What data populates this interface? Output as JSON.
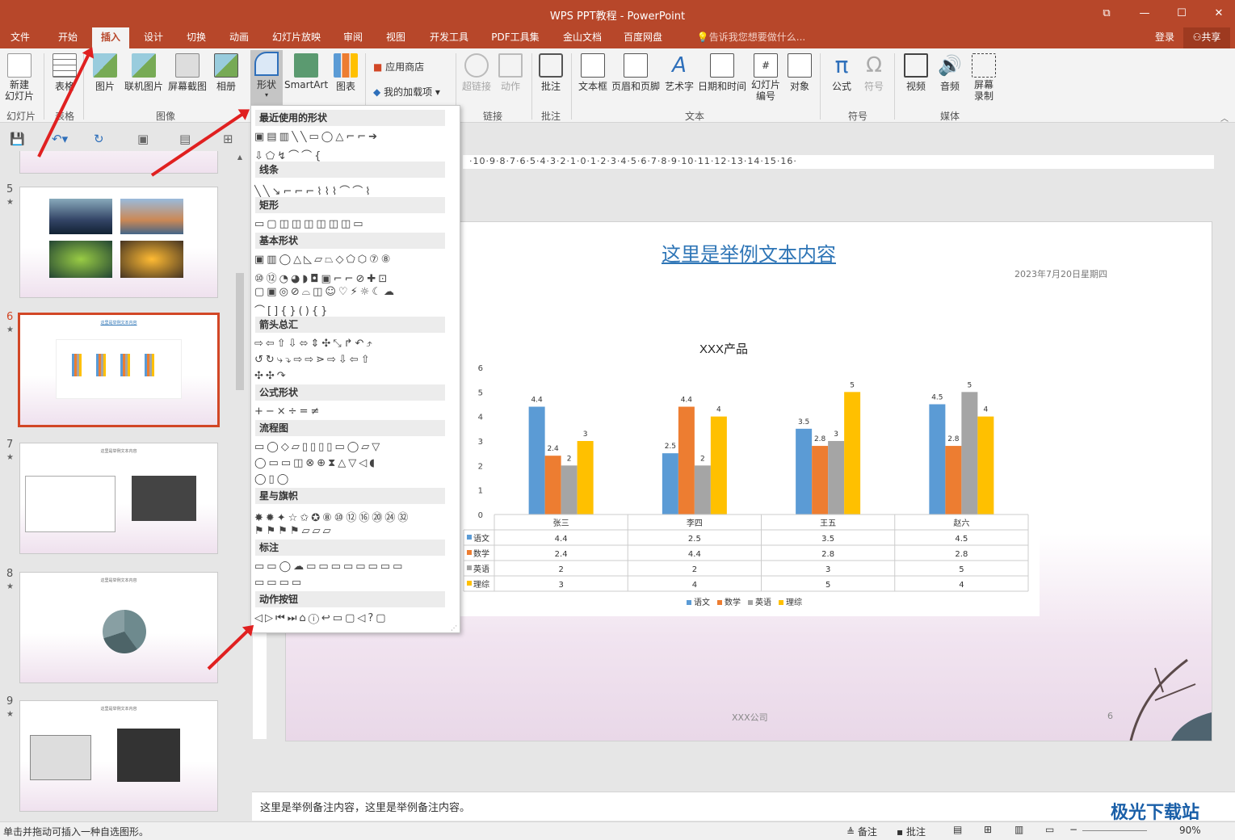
{
  "app": {
    "title": "WPS PPT教程 - PowerPoint"
  },
  "menu": {
    "items": [
      "文件",
      "开始",
      "插入",
      "设计",
      "切换",
      "动画",
      "幻灯片放映",
      "审阅",
      "视图",
      "开发工具",
      "PDF工具集",
      "金山文档",
      "百度网盘"
    ],
    "tellme": "告诉我您想要做什么...",
    "login": "登录",
    "share": "共享"
  },
  "ribbon": {
    "new_slide": "新建\n幻灯片",
    "table": "表格",
    "picture": "图片",
    "online_picture": "联机图片",
    "screenshot": "屏幕截图",
    "album": "相册",
    "shapes": "形状",
    "smartart": "SmartArt",
    "chart": "图表",
    "store": "应用商店",
    "addins": "我的加载项",
    "hyperlink": "超链接",
    "action": "动作",
    "comment": "批注",
    "textbox": "文本框",
    "header_footer": "页眉和页脚",
    "wordart": "艺术字",
    "datetime": "日期和时间",
    "slide_num": "幻灯片\n编号",
    "object": "对象",
    "equation": "公式",
    "symbol": "符号",
    "video": "视频",
    "audio": "音频",
    "screen_rec": "屏幕\n录制",
    "groups": {
      "slides": "幻灯片",
      "tables": "表格",
      "images": "图像",
      "links": "链接",
      "comments": "批注",
      "text": "文本",
      "symbols": "符号",
      "media": "媒体"
    }
  },
  "shapes_menu": {
    "sections": [
      "最近使用的形状",
      "线条",
      "矩形",
      "基本形状",
      "箭头总汇",
      "公式形状",
      "流程图",
      "星与旗帜",
      "标注",
      "动作按钮"
    ]
  },
  "thumbs": [
    {
      "n": "5"
    },
    {
      "n": "6"
    },
    {
      "n": "7"
    },
    {
      "n": "8"
    },
    {
      "n": "9"
    }
  ],
  "slide": {
    "title": "这里是举例文本内容",
    "date": "2023年7月20日星期四",
    "company": "XXX公司",
    "page": "6"
  },
  "chart_data": {
    "type": "bar",
    "title": "XXX产品",
    "categories": [
      "张三",
      "李四",
      "王五",
      "赵六"
    ],
    "ylim": [
      0,
      6
    ],
    "yticks": [
      "0",
      "1",
      "2",
      "3",
      "4",
      "5",
      "6"
    ],
    "series": [
      {
        "name": "语文",
        "color": "#5b9bd5",
        "values": [
          4.4,
          2.5,
          3.5,
          4.5
        ]
      },
      {
        "name": "数学",
        "color": "#ed7d31",
        "values": [
          2.4,
          4.4,
          2.8,
          2.8
        ]
      },
      {
        "name": "英语",
        "color": "#a5a5a5",
        "values": [
          2,
          2,
          3,
          5
        ]
      },
      {
        "name": "理综",
        "color": "#ffc000",
        "values": [
          3,
          4,
          5,
          4
        ]
      }
    ],
    "legend": "bottom"
  },
  "chart_table": {
    "rows": [
      [
        "语文",
        "4.4",
        "2.5",
        "3.5",
        "4.5"
      ],
      [
        "数学",
        "2.4",
        "4.4",
        "2.8",
        "2.8"
      ],
      [
        "英语",
        "2",
        "2",
        "3",
        "5"
      ],
      [
        "理综",
        "3",
        "4",
        "5",
        "4"
      ]
    ]
  },
  "notes": "这里是举例备注内容，这里是举例备注内容。",
  "status": {
    "hint": "单击并拖动可插入一种自选图形。",
    "notes_btn": "备注",
    "comments_btn": "批注",
    "zoom": "90%"
  },
  "watermark": "极光下载站"
}
